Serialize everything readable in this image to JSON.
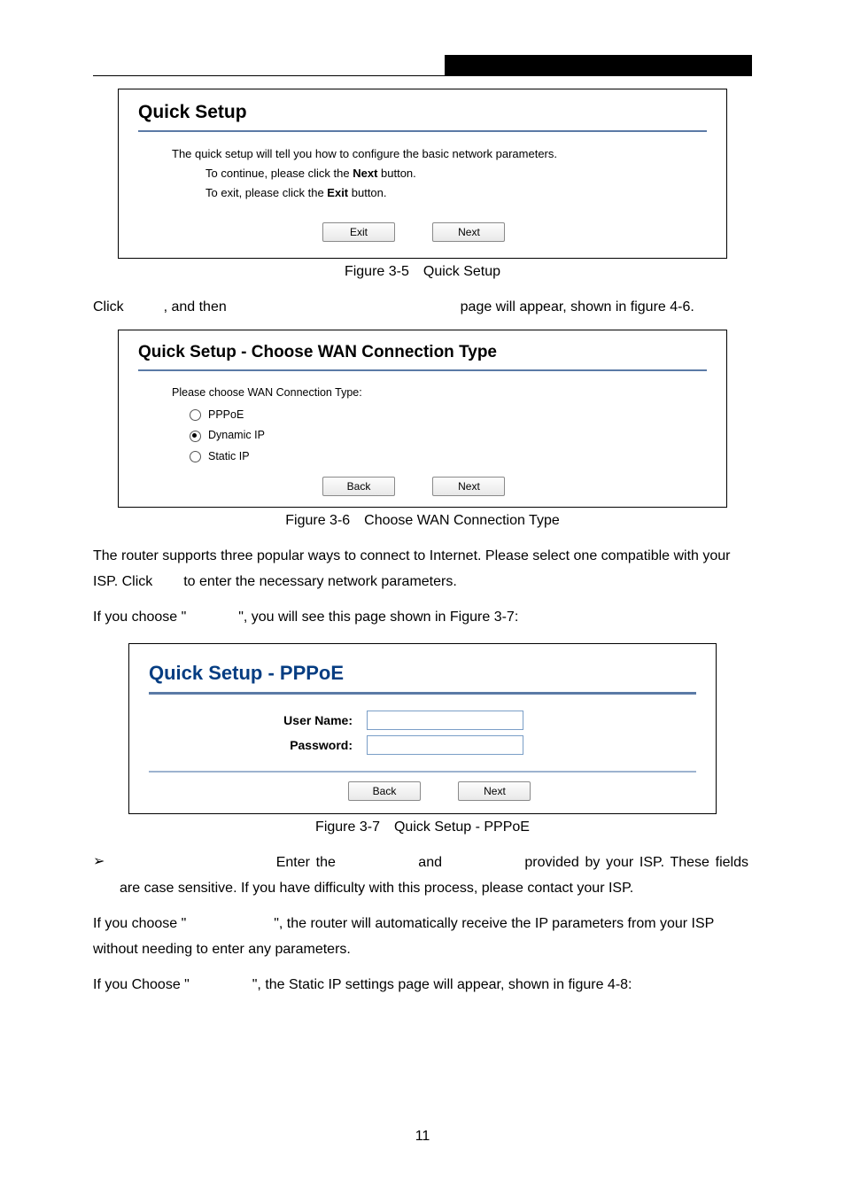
{
  "figA": {
    "title": "Quick Setup",
    "line1": "The quick setup will tell you how to configure the basic network parameters.",
    "line2_a": "To continue, please click the ",
    "line2_b": "Next",
    "line2_c": " button.",
    "line3_a": "To exit, please click the ",
    "line3_b": "Exit",
    "line3_c": " button.",
    "btn_exit": "Exit",
    "btn_next": "Next",
    "caption": "Figure 3-5 Quick Setup"
  },
  "para1_a": "Click ",
  "para1_b": ", and then ",
  "para1_c": " page will appear, shown in figure 4-6.",
  "figB": {
    "title": "Quick Setup - Choose WAN Connection Type",
    "prompt": "Please choose WAN Connection Type:",
    "opt1": "PPPoE",
    "opt2": "Dynamic IP",
    "opt3": "Static IP",
    "btn_back": "Back",
    "btn_next": "Next",
    "caption": "Figure 3-6 Choose WAN Connection Type"
  },
  "para2_a": "The router supports three popular ways to connect to Internet. Please select one compatible with your ISP. Click ",
  "para2_b": " to enter the necessary network parameters.",
  "para3_a": "If you choose \" ",
  "para3_b": " \", you will see this page shown in Figure 3-7:",
  "figC": {
    "title": "Quick Setup - PPPoE",
    "lab_user": "User Name:",
    "lab_pass": "Password:",
    "btn_back": "Back",
    "btn_next": "Next",
    "caption": "Figure 3-7 Quick Setup - PPPoE"
  },
  "bullet": {
    "seg1": "Enter the ",
    "seg2": " and ",
    "seg3": " provided by your ISP. These fields are case sensitive. If you have difficulty with this process, please contact your ISP."
  },
  "para4_a": "If you choose \" ",
  "para4_b": " \", the router will automatically receive the IP parameters from your ISP without needing to enter any parameters.",
  "para5_a": "If you Choose \" ",
  "para5_b": " \", the Static IP settings page will appear, shown in figure 4-8:",
  "page_number": "11",
  "bullet_glyph": "➢"
}
